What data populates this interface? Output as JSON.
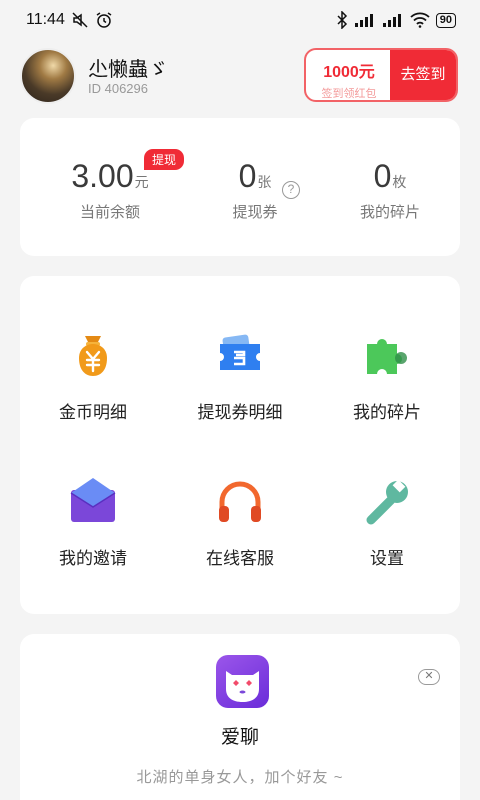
{
  "status_bar": {
    "time": "11:44",
    "battery": "90"
  },
  "profile": {
    "nickname": "尐懒蟲ゞ",
    "id_text": "ID  406296"
  },
  "checkin": {
    "amount": "1000元",
    "subtitle": "签到领红包",
    "button_label": "去签到"
  },
  "stats": {
    "balance": {
      "value": "3.00",
      "unit": "元",
      "label": "当前余额",
      "badge": "提现"
    },
    "vouchers": {
      "value": "0",
      "unit": "张",
      "label": "提现券",
      "help": "?"
    },
    "fragments": {
      "value": "0",
      "unit": "枚",
      "label": "我的碎片"
    }
  },
  "menu": {
    "items": [
      {
        "label": "金币明细",
        "icon": "money-bag-icon"
      },
      {
        "label": "提现券明细",
        "icon": "ticket-icon"
      },
      {
        "label": "我的碎片",
        "icon": "puzzle-icon"
      },
      {
        "label": "我的邀请",
        "icon": "envelope-icon"
      },
      {
        "label": "在线客服",
        "icon": "headphones-icon"
      },
      {
        "label": "设置",
        "icon": "wrench-icon"
      }
    ]
  },
  "ad": {
    "app_name": "爱聊",
    "description": "北湖的单身女人，加个好友 ~",
    "close": "✕"
  },
  "colors": {
    "accent_red": "#f02b36",
    "background": "#f4f4f4"
  }
}
